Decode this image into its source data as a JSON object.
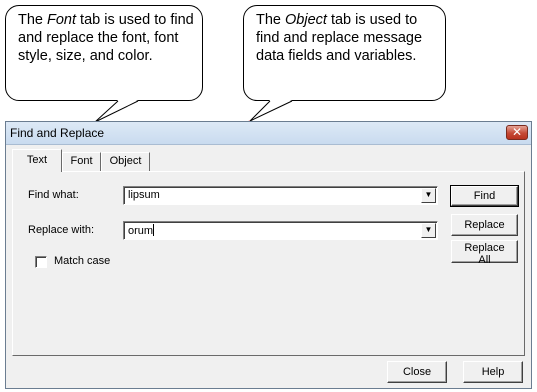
{
  "callouts": {
    "font": {
      "prefix": "The ",
      "emph": "Font",
      "rest": " tab is used to find and replace the font, font style, size, and color."
    },
    "object": {
      "prefix": "The ",
      "emph": "Object",
      "rest": " tab is used to find and replace message data fields and variables."
    },
    "line_color": "#e8302a"
  },
  "dialog": {
    "title": "Find and Replace",
    "close_glyph": "✕",
    "tabs": [
      {
        "label": "Text",
        "active": true
      },
      {
        "label": "Font",
        "active": false
      },
      {
        "label": "Object",
        "active": false
      }
    ],
    "find_label": "Find what:",
    "find_value": "lipsum",
    "replace_label": "Replace with:",
    "replace_value": "orum",
    "dropdown_glyph": "▼",
    "match_case_label": "Match case",
    "match_case_checked": false,
    "buttons": {
      "find": "Find",
      "replace": "Replace",
      "replace_all": "Replace All",
      "close": "Close",
      "help": "Help"
    }
  }
}
